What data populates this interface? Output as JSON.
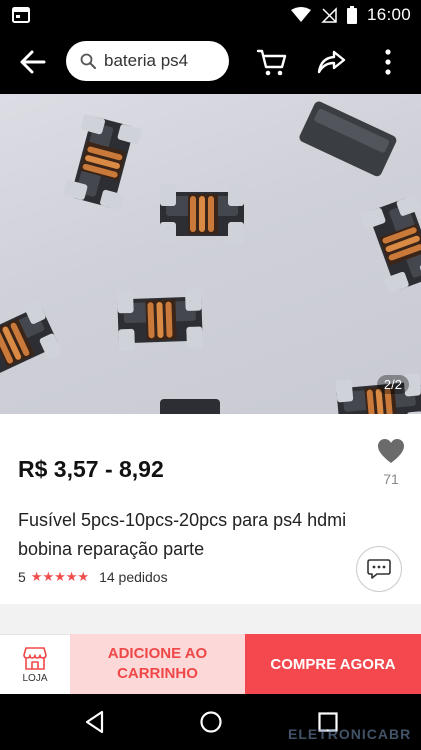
{
  "status_bar": {
    "time": "16:00"
  },
  "search": {
    "query": "bateria ps4"
  },
  "gallery": {
    "pager": "2/2"
  },
  "product": {
    "price": "R$ 3,57 - 8,92",
    "favorites": "71",
    "title": "Fusível 5pcs-10pcs-20pcs para ps4 hdmi bobina reparação parte",
    "rating_value": "5",
    "stars": "★★★★★",
    "orders": "14 pedidos"
  },
  "actions": {
    "store_label": "LOJA",
    "add_to_cart": "ADICIONE AO\nCARRINHO",
    "buy_now": "COMPRE AGORA"
  },
  "watermark": "ELETRONICABR",
  "colors": {
    "accent": "#f3484d",
    "accent_light": "#fcd8d8"
  }
}
